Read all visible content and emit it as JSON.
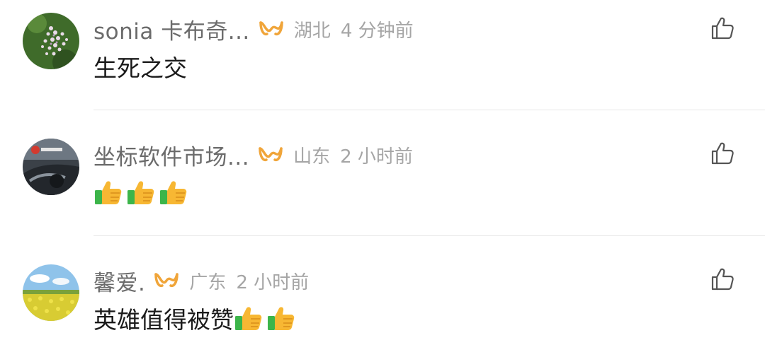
{
  "comments": [
    {
      "username": "sonia 卡布奇...",
      "location": "湖北",
      "time": "4 分钟前",
      "text": "生死之交",
      "emoji_count": 0,
      "avatar_icon": "lilac-flowers-avatar"
    },
    {
      "username": "坐标软件市场...",
      "location": "山东",
      "time": "2 小时前",
      "text": "",
      "emoji_count": 3,
      "avatar_icon": "car-interior-avatar"
    },
    {
      "username": "馨爱.",
      "location": "广东",
      "time": "2 小时前",
      "text": "英雄值得被赞",
      "emoji_count": 2,
      "avatar_icon": "rapeseed-field-avatar"
    }
  ],
  "icons": {
    "badge": "vip-wave-badge-icon",
    "like": "thumbs-up-outline-icon",
    "emoji": "thumbs-up-emoji-icon"
  },
  "colors": {
    "badge": "#f0a53a",
    "username": "#6b6b6b",
    "meta": "#a5a5a5",
    "text": "#1a1a1a"
  }
}
